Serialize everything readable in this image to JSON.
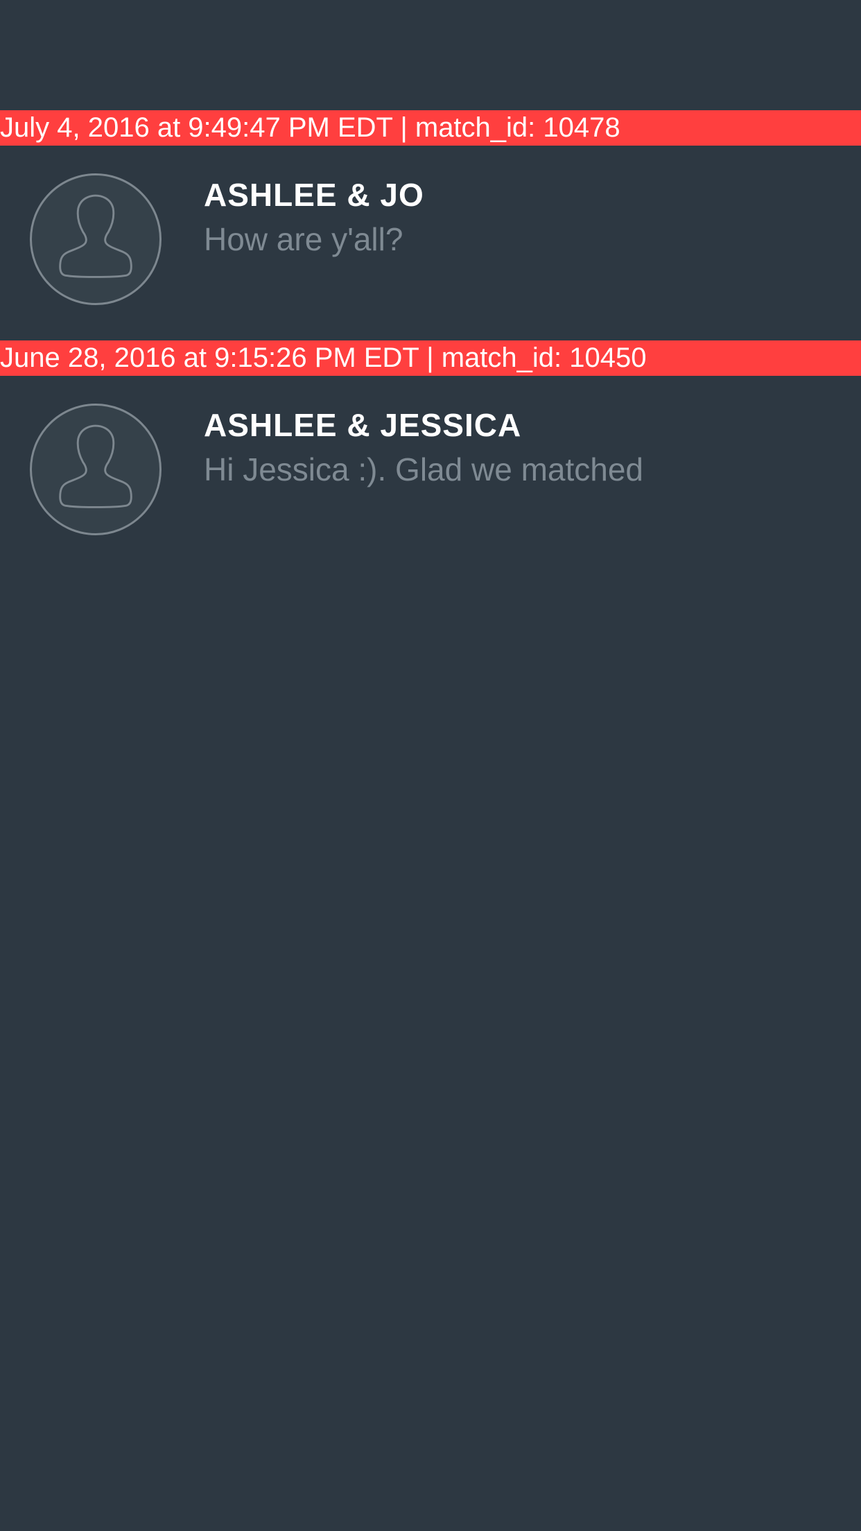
{
  "colors": {
    "background": "#2d3842",
    "banner": "#ff3f3f",
    "name_text": "#ffffff",
    "message_text": "#7f8a93",
    "avatar_outline": "#7d878f"
  },
  "matches": [
    {
      "banner": "July 4, 2016 at 9:49:47 PM EDT | match_id: 10478",
      "name": "ASHLEE & JO",
      "message": "How are y'all?",
      "avatar_icon": "person-placeholder-icon"
    },
    {
      "banner": "June 28, 2016 at 9:15:26 PM EDT | match_id: 10450",
      "name": "ASHLEE & JESSICA",
      "message": "Hi Jessica :). Glad we matched",
      "avatar_icon": "person-placeholder-icon"
    }
  ]
}
